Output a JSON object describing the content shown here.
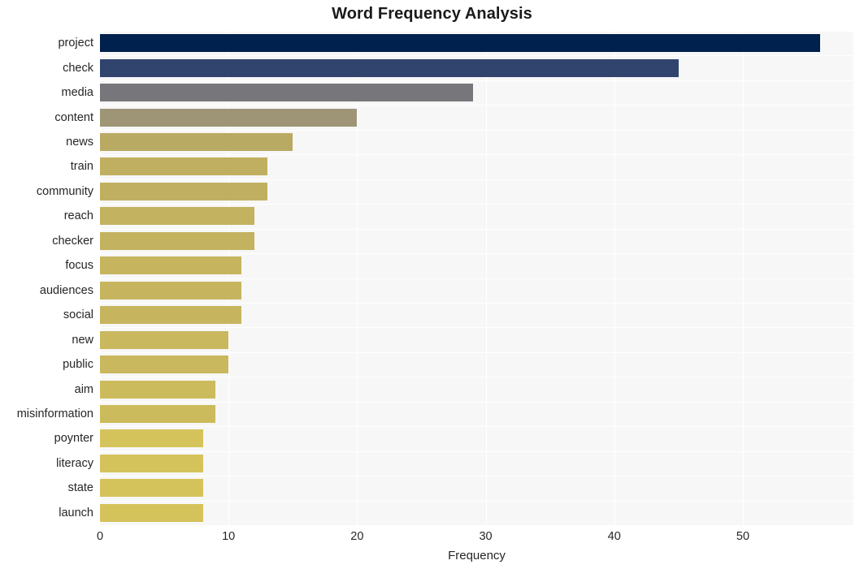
{
  "chart_data": {
    "type": "bar",
    "orientation": "horizontal",
    "title": "Word Frequency Analysis",
    "xlabel": "Frequency",
    "ylabel": "",
    "categories": [
      "project",
      "check",
      "media",
      "content",
      "news",
      "train",
      "community",
      "reach",
      "checker",
      "focus",
      "audiences",
      "social",
      "new",
      "public",
      "aim",
      "misinformation",
      "poynter",
      "literacy",
      "state",
      "launch"
    ],
    "values": [
      56,
      45,
      29,
      20,
      15,
      13,
      13,
      12,
      12,
      11,
      11,
      11,
      10,
      10,
      9,
      9,
      8,
      8,
      8,
      8
    ],
    "bar_colors": [
      "#00204d",
      "#31446e",
      "#77767a",
      "#9d9576",
      "#b9aa63",
      "#c0af60",
      "#c0af60",
      "#c3b25f",
      "#c3b25f",
      "#c6b55e",
      "#c6b55e",
      "#c6b55e",
      "#c9b85d",
      "#c9b85d",
      "#ccbb5c",
      "#ccbb5c",
      "#d4c35b",
      "#d4c35b",
      "#d4c35b",
      "#d4c35b"
    ],
    "xlim": [
      0,
      58.6
    ],
    "ylim": [
      0,
      20
    ],
    "xticks": [
      0,
      10,
      20,
      30,
      40,
      50
    ],
    "xtick_labels": [
      "0",
      "10",
      "20",
      "30",
      "40",
      "50"
    ],
    "grid": true,
    "grid_color": "#ffffff",
    "grid_axis": "both",
    "legend": "none",
    "plot_background": "#f7f7f7",
    "figure_background": "#ffffff",
    "title_color": "#1a1a1a",
    "tick_color": "#262626"
  }
}
